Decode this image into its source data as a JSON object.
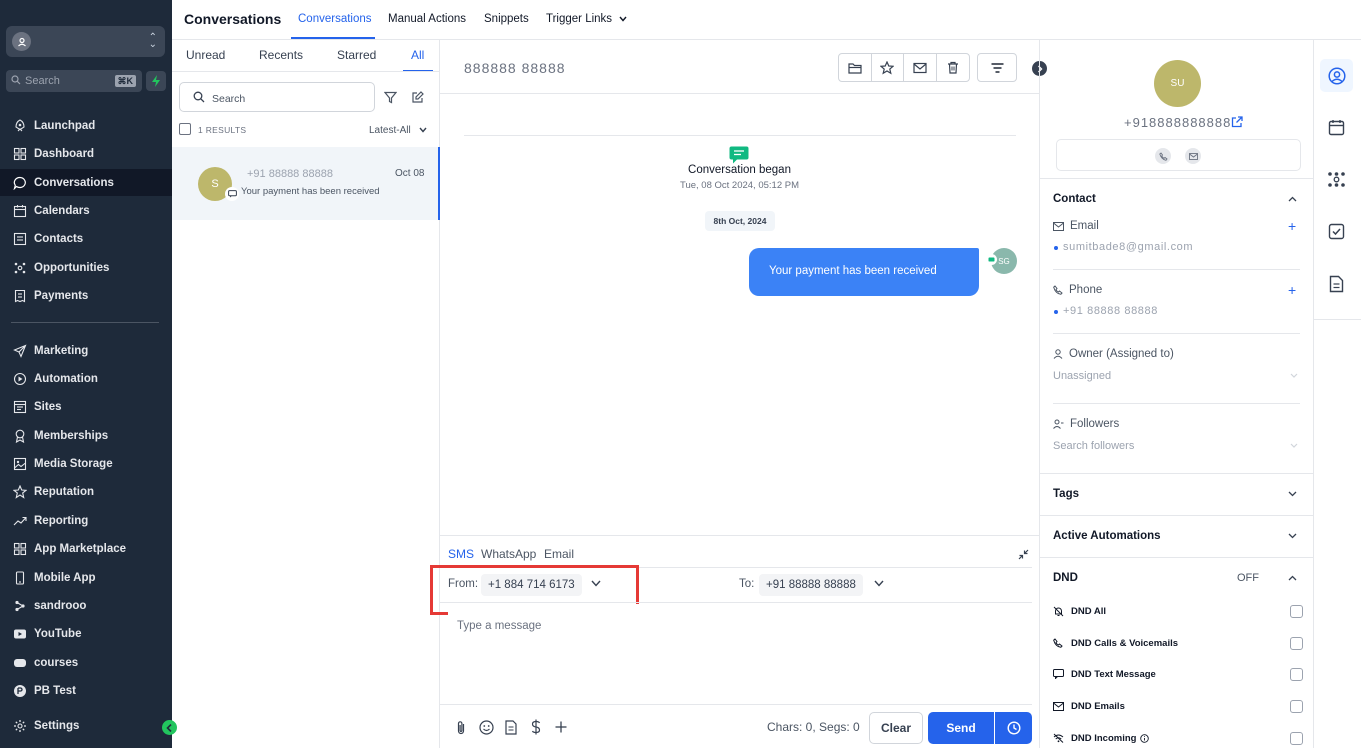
{
  "sidebar": {
    "search_placeholder": "Search",
    "search_shortcut": "⌘K",
    "items": [
      {
        "label": "Launchpad",
        "icon": "rocket-icon"
      },
      {
        "label": "Dashboard",
        "icon": "grid-icon"
      },
      {
        "label": "Conversations",
        "icon": "chat-icon",
        "active": true
      },
      {
        "label": "Calendars",
        "icon": "calendar-icon"
      },
      {
        "label": "Contacts",
        "icon": "contact-card-icon"
      },
      {
        "label": "Opportunities",
        "icon": "pipeline-icon"
      },
      {
        "label": "Payments",
        "icon": "receipt-icon"
      },
      {
        "label": "Marketing",
        "icon": "send-icon"
      },
      {
        "label": "Automation",
        "icon": "automation-icon"
      },
      {
        "label": "Sites",
        "icon": "sites-icon"
      },
      {
        "label": "Memberships",
        "icon": "award-icon"
      },
      {
        "label": "Media Storage",
        "icon": "image-icon"
      },
      {
        "label": "Reputation",
        "icon": "star-icon"
      },
      {
        "label": "Reporting",
        "icon": "trend-icon"
      },
      {
        "label": "App Marketplace",
        "icon": "apps-icon"
      },
      {
        "label": "Mobile App",
        "icon": "phone-icon"
      },
      {
        "label": "sandrooo",
        "icon": "custom-link-icon"
      },
      {
        "label": "YouTube",
        "icon": "youtube-icon"
      },
      {
        "label": "courses",
        "icon": "courses-icon"
      },
      {
        "label": "PB Test",
        "icon": "pb-icon"
      },
      {
        "label": "Settings",
        "icon": "gear-icon"
      }
    ]
  },
  "topbar": {
    "title": "Conversations",
    "tabs": [
      "Conversations",
      "Manual Actions",
      "Snippets",
      "Trigger Links"
    ]
  },
  "list": {
    "tabs": [
      "Unread",
      "Recents",
      "Starred",
      "All"
    ],
    "search_placeholder": "Search",
    "results": "1 RESULTS",
    "sort": "Latest-All",
    "item": {
      "initial": "S",
      "name": "+91 88888 88888",
      "date": "Oct 08",
      "preview": "Your payment has been received"
    }
  },
  "thread": {
    "contact_name": "888888 88888",
    "began_title": "Conversation began",
    "began_date": "Tue, 08 Oct 2024, 05:12 PM",
    "day_chip": "8th Oct, 2024",
    "message": "Your payment has been received",
    "sender_initials": "SG"
  },
  "composer": {
    "channels": [
      "SMS",
      "WhatsApp",
      "Email"
    ],
    "from_label": "From:",
    "from_value": "+1 884 714 6173",
    "to_label": "To:",
    "to_value": "+91 88888 88888",
    "placeholder": "Type a message",
    "chars": "Chars: 0, Segs: 0",
    "clear_label": "Clear",
    "send_label": "Send"
  },
  "contact": {
    "initials": "SU",
    "phone_display": "+918888888888",
    "contact_section": "Contact",
    "email_label": "Email",
    "email_value": "sumitbade8@gmail.com",
    "phone_label": "Phone",
    "phone_value": "+91 88888 88888",
    "owner_label": "Owner (Assigned to)",
    "owner_value": "Unassigned",
    "followers_label": "Followers",
    "followers_placeholder": "Search followers",
    "tags": "Tags",
    "automations": "Active Automations",
    "dnd": "DND",
    "dnd_status": "OFF",
    "dnd_items": [
      "DND All",
      "DND Calls & Voicemails",
      "DND Text Message",
      "DND Emails",
      "DND Incoming"
    ]
  },
  "colors": {
    "sidebar_bg": "#1e2a3a",
    "accent": "#2563eb",
    "highlight_box": "#e53935",
    "avatar": "#bdb76b"
  }
}
